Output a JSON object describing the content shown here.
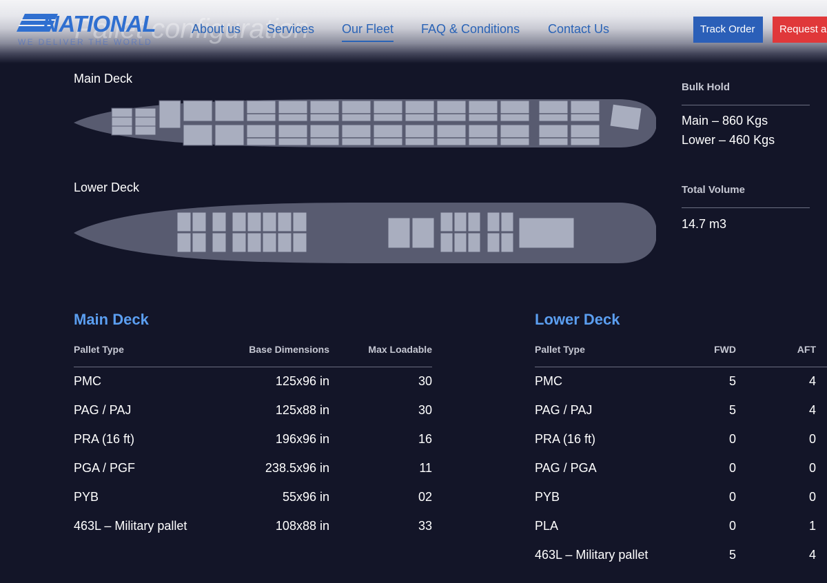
{
  "header": {
    "logo_text": "NATIONAL",
    "logo_tagline": "WE DELIVER THE WORLD",
    "page_title": "Pallet configuration",
    "nav": [
      {
        "label": "About us"
      },
      {
        "label": "Services"
      },
      {
        "label": "Our Fleet"
      },
      {
        "label": "FAQ & Conditions"
      },
      {
        "label": "Contact Us"
      }
    ],
    "track_order_label": "Track Order",
    "request_label": "Request a"
  },
  "diagram": {
    "main_deck_label": "Main Deck",
    "lower_deck_label": "Lower Deck"
  },
  "info": {
    "bulk_hold": {
      "heading": "Bulk Hold",
      "lines": [
        "Main – 860 Kgs",
        "Lower – 460 Kgs"
      ]
    },
    "total_volume": {
      "heading": "Total Volume",
      "value": "14.7 m3"
    }
  },
  "main_table": {
    "title": "Main Deck",
    "headers": [
      "Pallet Type",
      "Base Dimensions",
      "Max Loadable"
    ],
    "rows": [
      [
        "PMC",
        "125x96 in",
        "30"
      ],
      [
        "PAG / PAJ",
        "125x88 in",
        "30"
      ],
      [
        "PRA (16 ft)",
        "196x96 in",
        "16"
      ],
      [
        "PGA / PGF",
        "238.5x96 in",
        "11"
      ],
      [
        "PYB",
        "55x96 in",
        "02"
      ],
      [
        "463L – Military pallet",
        "108x88 in",
        "33"
      ]
    ]
  },
  "lower_table": {
    "title": "Lower Deck",
    "headers": [
      "Pallet Type",
      "FWD",
      "AFT"
    ],
    "rows": [
      [
        "PMC",
        "5",
        "4"
      ],
      [
        "PAG / PAJ",
        "5",
        "4"
      ],
      [
        "PRA (16 ft)",
        "0",
        "0"
      ],
      [
        "PAG / PGA",
        "0",
        "0"
      ],
      [
        "PYB",
        "0",
        "0"
      ],
      [
        "PLA",
        "0",
        "1"
      ],
      [
        "463L – Military pallet",
        "5",
        "4"
      ]
    ]
  },
  "colors": {
    "background": "#131528",
    "accent_blue": "#5b9ef0",
    "fuselage": "#585b70",
    "pallet": "#a9aebf",
    "track_button": "#2b5fb8",
    "request_button": "#e0383a"
  }
}
